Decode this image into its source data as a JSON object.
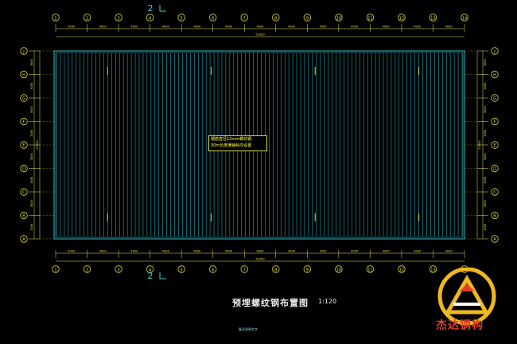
{
  "drawing": {
    "title": "预埋螺纹钢布置图",
    "scale": "1:120",
    "footnote": "备注说明文字",
    "section_mark": "2",
    "note_lines": [
      "钢筋直径12mm螺纹钢",
      "30m长度满铺纵向设置"
    ],
    "top_dims": [
      "4000",
      "4000",
      "4000",
      "4000",
      "4000",
      "4000",
      "4000",
      "4000",
      "4000",
      "4000",
      "4000",
      "4000",
      "4000"
    ],
    "bottom_dims": [
      "4000",
      "4000",
      "4000",
      "4000",
      "4000",
      "4000",
      "4000",
      "4000",
      "4000",
      "4000",
      "4000",
      "4000",
      "4000"
    ],
    "total_dim": "52000",
    "left_dims": [
      "3000",
      "3000",
      "3000",
      "3000",
      "3000",
      "3000",
      "3000",
      "3000",
      "3000"
    ],
    "right_dims": [
      "3000",
      "3000",
      "3000",
      "3000",
      "3000",
      "3000",
      "3000",
      "3000",
      "3000"
    ],
    "total_side_dim": "27000"
  },
  "axes": {
    "columns": [
      "1",
      "2",
      "3",
      "4",
      "5",
      "6",
      "7",
      "8",
      "9",
      "10",
      "11",
      "12",
      "13",
      "14"
    ],
    "rows": [
      "J",
      "H",
      "G",
      "F",
      "E",
      "D",
      "C",
      "B",
      "A"
    ]
  },
  "colors": {
    "dim": "#e6e65a",
    "steel": "#20b4c4",
    "outline": "#40d0d8",
    "axis_bubble": "#d8d840",
    "accent": "#e23b2b",
    "logo_gold": "#f0b820"
  },
  "logo": {
    "text": "杰达钢构"
  }
}
